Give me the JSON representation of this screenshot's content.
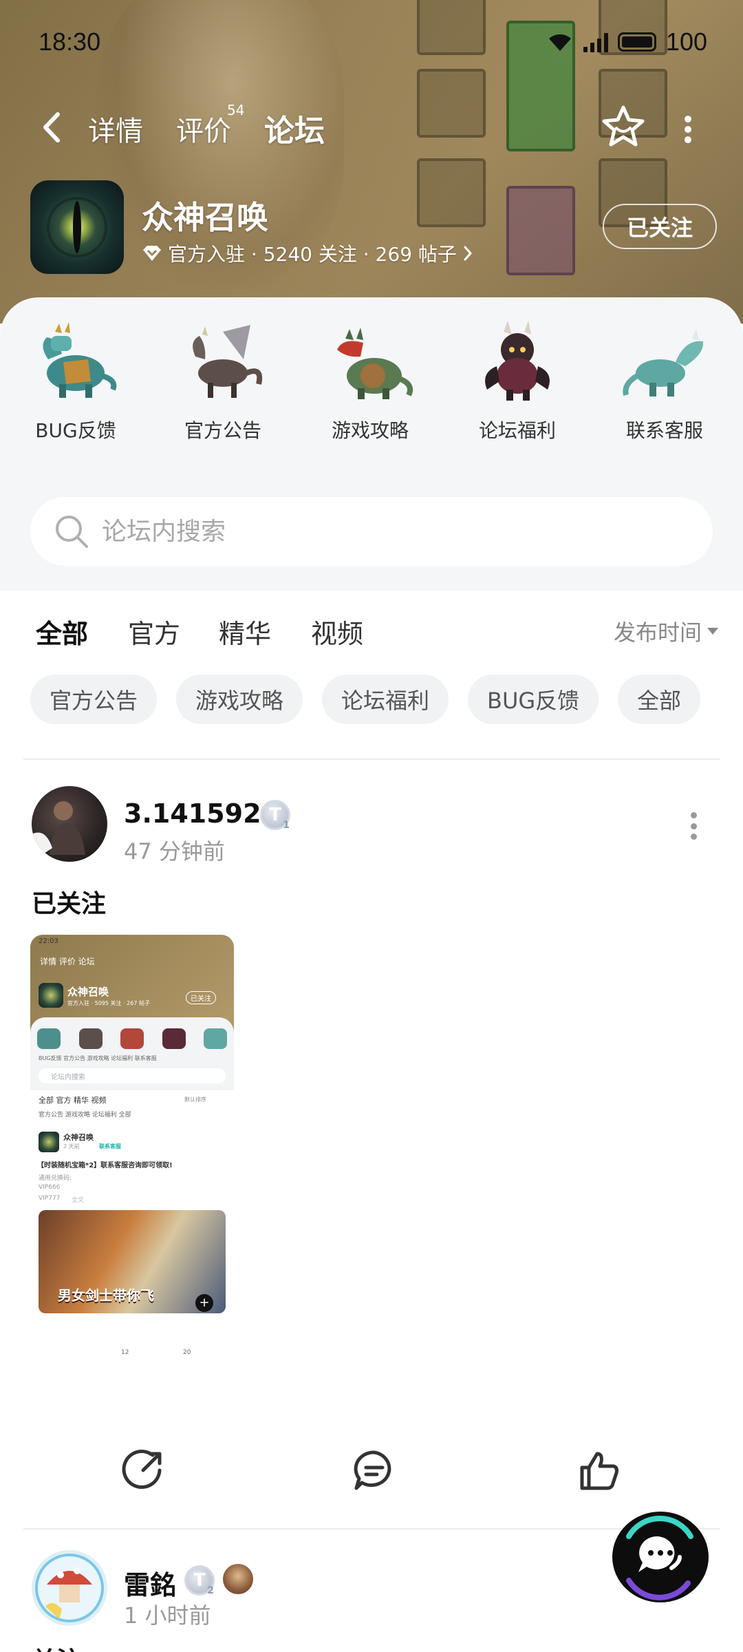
{
  "status_bar": {
    "time": "18:30",
    "battery": "100"
  },
  "nav": {
    "tabs": [
      {
        "label": "详情"
      },
      {
        "label": "评价"
      },
      {
        "label": "论坛"
      }
    ],
    "review_count": "54"
  },
  "game": {
    "name": "众神召唤",
    "meta": "官方入驻 · 5240 关注 · 269 帖子",
    "follow_label": "已关注"
  },
  "categories": [
    {
      "label": "BUG反馈"
    },
    {
      "label": "官方公告"
    },
    {
      "label": "游戏攻略"
    },
    {
      "label": "论坛福利"
    },
    {
      "label": "联系客服"
    }
  ],
  "search": {
    "placeholder": "论坛内搜索"
  },
  "filters": {
    "tabs": [
      {
        "label": "全部"
      },
      {
        "label": "官方"
      },
      {
        "label": "精华"
      },
      {
        "label": "视频"
      }
    ],
    "sort": "发布时间",
    "chips": [
      {
        "label": "官方公告"
      },
      {
        "label": "游戏攻略"
      },
      {
        "label": "论坛福利"
      },
      {
        "label": "BUG反馈"
      },
      {
        "label": "全部"
      }
    ]
  },
  "posts": [
    {
      "author": "3.1415926",
      "level": "1",
      "time": "47 分钟前",
      "title": "已关注",
      "thumbnail": {
        "time": "22:03",
        "nav": "详情  评价  论坛",
        "game_name": "众神召唤",
        "game_meta": "官方入驻 · 5095 关注 · 267 帖子",
        "follow": "已关注",
        "categories": "BUG反馈  官方公告  游戏攻略  论坛福利  联系客服",
        "search": "论坛内搜索",
        "tabs": "全部  官方  精华  视频",
        "sort": "默认排序",
        "chips": "官方公告  游戏攻略  论坛福利  全部",
        "post_author": "众神召唤",
        "post_time": "2 天前",
        "post_tag": "联系客服",
        "post_title": "【时装随机宝箱*2】联系客服咨询即可领取!",
        "line1": "通用兑换码:",
        "line2": "VIP666",
        "line3": "VIP777",
        "line3_more": "全文",
        "banner_text": "男女剑士带你飞",
        "comments": "12",
        "likes": "20"
      }
    },
    {
      "author": "雷銘",
      "level": "2",
      "time": "1 小时前",
      "title": "关注"
    }
  ],
  "icons": {
    "back": "chevron-left-icon",
    "favorite": "star-icon",
    "more": "more-vertical-icon",
    "search": "search-icon",
    "share": "share-icon",
    "comment": "comment-icon",
    "like": "thumbs-up-icon",
    "fab": "chat-bubble-icon"
  },
  "colors": {
    "accent": "#19d3c0",
    "header": "#a99061"
  }
}
